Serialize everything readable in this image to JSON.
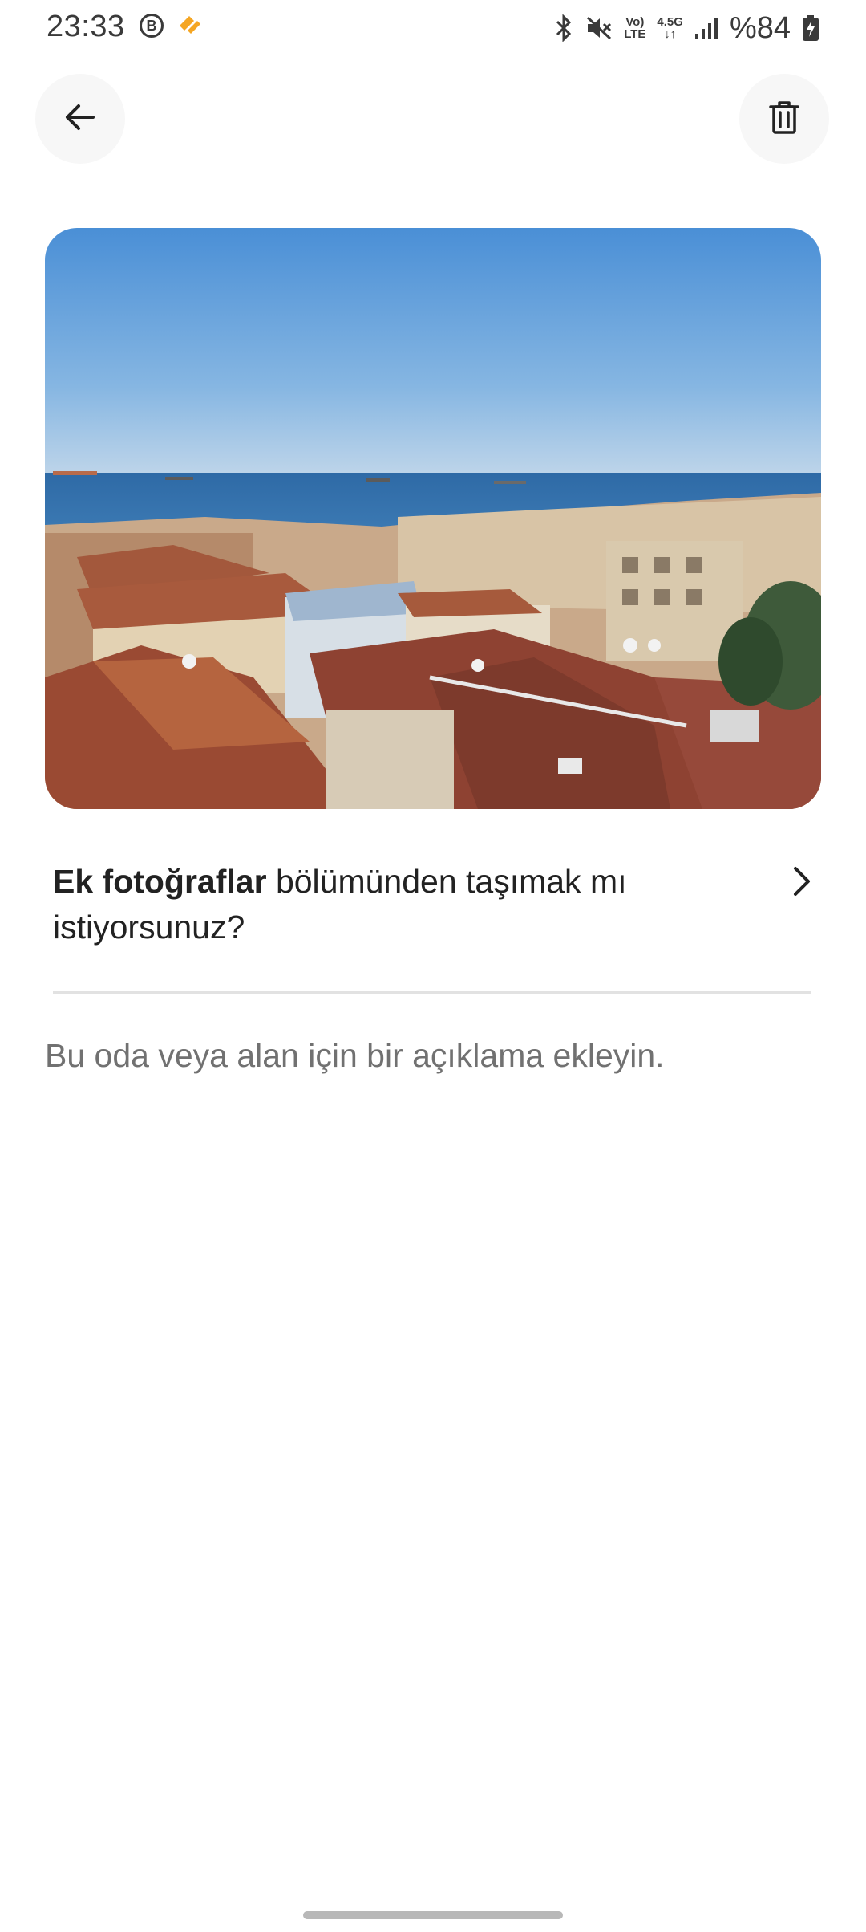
{
  "status_bar": {
    "time": "23:33",
    "b_badge": "B",
    "network_top": "Vo)",
    "network_bottom": "LTE",
    "generation_top": "4.5G",
    "generation_bottom": "↓↑",
    "battery": "%84"
  },
  "header": {
    "back_icon": "arrow-left-icon",
    "delete_icon": "trash-icon"
  },
  "photo": {
    "subject": "rooftops-seaview-photo"
  },
  "move_prompt": {
    "bold": "Ek fotoğraflar",
    "rest": " bölümünden taşımak mı istiyorsunuz?",
    "chevron_icon": "chevron-right-icon"
  },
  "description_placeholder": "Bu oda veya alan için bir açıklama ekleyin.",
  "colors": {
    "text": "#222222",
    "secondary_text": "#717171",
    "divider": "#e2e2e2",
    "button_bg": "#f7f7f7",
    "accent_orange": "#f5a623"
  }
}
